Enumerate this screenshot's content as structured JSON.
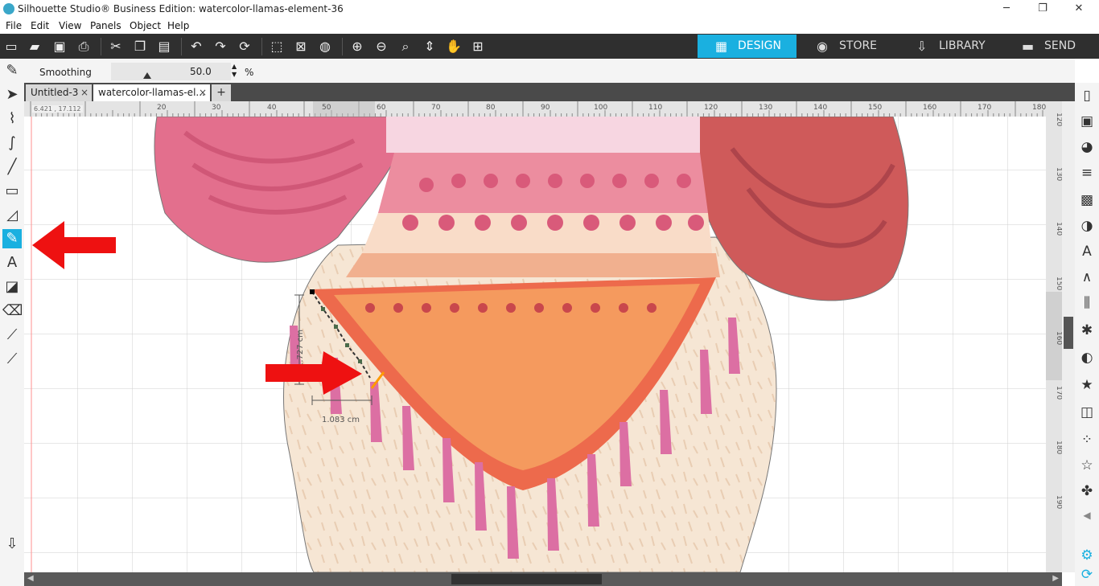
{
  "window": {
    "title": "Silhouette Studio® Business Edition: watercolor-llamas-element-36",
    "minimize": "─",
    "restore": "❐",
    "close": "✕"
  },
  "menu": [
    "File",
    "Edit",
    "View",
    "Panels",
    "Object",
    "Help"
  ],
  "mode_tabs": {
    "design": "DESIGN",
    "store": "STORE",
    "library": "LIBRARY",
    "send": "SEND"
  },
  "options": {
    "smoothing_label": "Smoothing",
    "smoothing_value": "50.0",
    "unit": "%",
    "smoothing_level": 0.5
  },
  "doc_tabs": [
    {
      "label": "Untitled-3",
      "close": "×"
    },
    {
      "label": "watercolor-llamas-el...",
      "close": "×"
    }
  ],
  "new_tab": "+",
  "ruler_top_labels": [
    "20",
    "30",
    "40",
    "50",
    "60",
    "70",
    "80",
    "90",
    "100",
    "110",
    "120",
    "130",
    "140",
    "150",
    "160",
    "170",
    "180"
  ],
  "ruler_right_labels": [
    "120",
    "130",
    "140",
    "150",
    "160",
    "170",
    "180",
    "190"
  ],
  "coord_readout": "6.421 , 17.112",
  "measurements": {
    "height": "1.727 cm",
    "width": "1.083 cm"
  },
  "colors": {
    "accent": "#1ab0e0",
    "toolbar": "#2f2f2f",
    "arrow": "#ee1111"
  }
}
